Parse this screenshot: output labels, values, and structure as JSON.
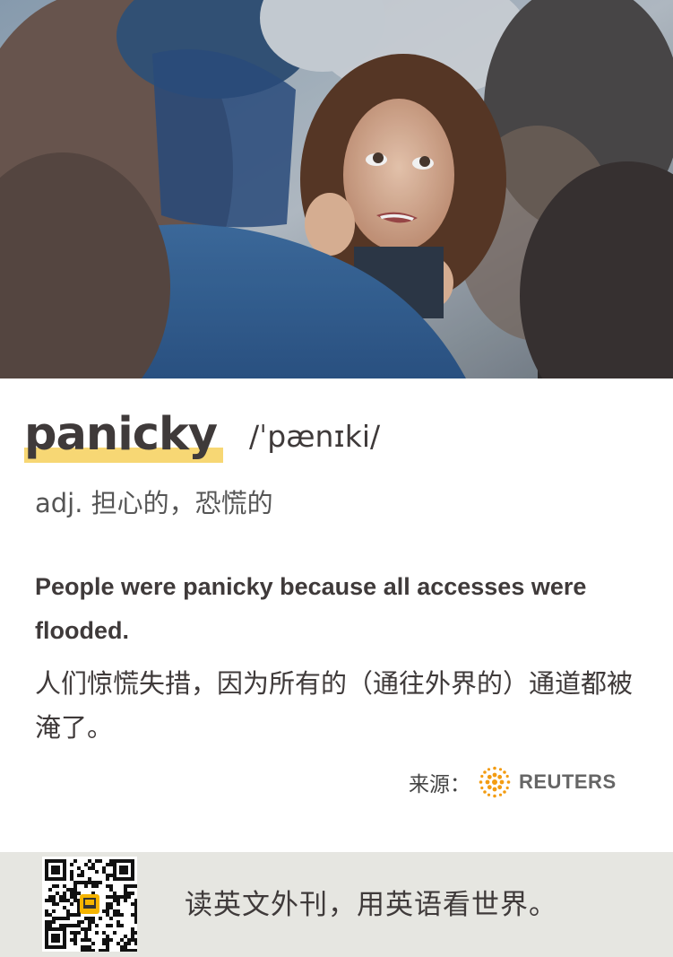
{
  "card": {
    "word": "panicky",
    "phonetic": "/ˈpænɪki/",
    "part_of_speech": "adj. 担心的，恐慌的",
    "example_en": "People were panicky because all accesses were flooded.",
    "example_zh": "人们惊慌失措，因为所有的（通往外界的）通道都被淹了。",
    "source_label": "来源：",
    "source_name": "REUTERS",
    "slogan": "读英文外刊，用英语看世界。"
  },
  "colors": {
    "highlight": "#f7d774",
    "text": "#3f3a3a",
    "footer_bg": "#e6e6e1",
    "reuters_orange": "#f39c12"
  },
  "icons": {
    "photo": "frightened-woman-in-crowd-photo",
    "source_logo": "reuters-logo-icon",
    "qr": "qr-code-icon"
  }
}
